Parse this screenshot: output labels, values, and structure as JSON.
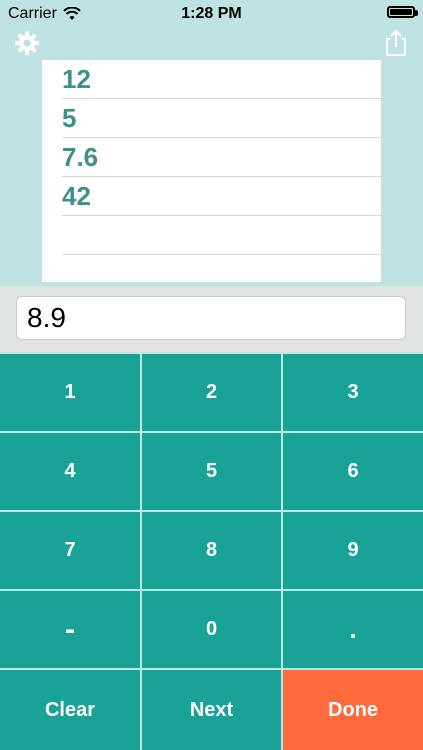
{
  "status": {
    "carrier": "Carrier",
    "time": "1:28 PM"
  },
  "toolbar": {
    "settings_icon": "gear-icon",
    "share_icon": "share-icon"
  },
  "list": {
    "values": [
      "12",
      "5",
      "7.6",
      "42",
      ""
    ]
  },
  "entry": {
    "value": "8.9"
  },
  "keypad": {
    "keys": [
      "1",
      "2",
      "3",
      "4",
      "5",
      "6",
      "7",
      "8",
      "9",
      "-",
      "0",
      ".",
      "Clear",
      "Next",
      "Done"
    ]
  },
  "colors": {
    "teal_key": "#19a397",
    "done_key": "#ff6a3d",
    "list_text": "#3f8f8c",
    "background": "#bfe3e0"
  }
}
